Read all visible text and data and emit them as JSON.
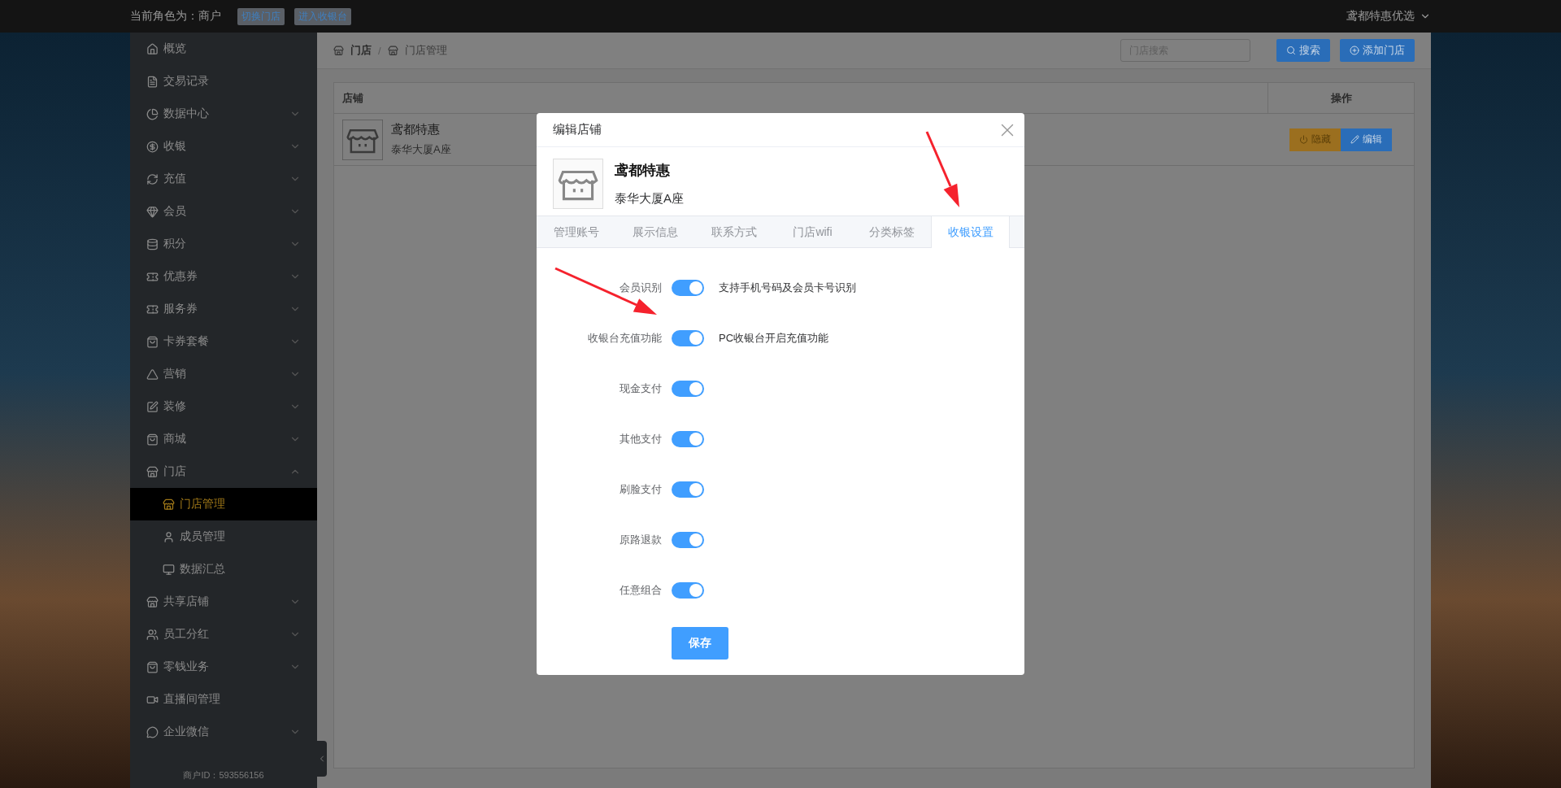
{
  "top_bar": {
    "role_text": "当前角色为：商户",
    "buttons": [
      "切换门店",
      "进入收银台"
    ],
    "user": "鸢都特惠优选"
  },
  "sidebar": {
    "items": [
      {
        "label": "概览",
        "kind": "link",
        "selected": false
      },
      {
        "label": "交易记录",
        "kind": "link",
        "selected": false
      },
      {
        "label": "数据中心",
        "kind": "group",
        "expanded": false,
        "selected": false
      },
      {
        "label": "收银",
        "kind": "group",
        "expanded": false,
        "selected": false
      },
      {
        "label": "充值",
        "kind": "group",
        "expanded": false,
        "selected": false
      },
      {
        "label": "会员",
        "kind": "group",
        "expanded": false,
        "selected": false
      },
      {
        "label": "积分",
        "kind": "group",
        "expanded": false,
        "selected": false
      },
      {
        "label": "优惠券",
        "kind": "group",
        "expanded": false,
        "selected": false
      },
      {
        "label": "服务券",
        "kind": "group",
        "expanded": false,
        "selected": false
      },
      {
        "label": "卡券套餐",
        "kind": "group",
        "expanded": false,
        "selected": false
      },
      {
        "label": "营销",
        "kind": "group",
        "expanded": false,
        "selected": false
      },
      {
        "label": "装修",
        "kind": "group",
        "expanded": false,
        "selected": false
      },
      {
        "label": "商城",
        "kind": "group",
        "expanded": false,
        "selected": false
      },
      {
        "label": "门店",
        "kind": "group",
        "expanded": true,
        "selected": false,
        "children": [
          {
            "label": "门店管理",
            "selected": true
          },
          {
            "label": "成员管理",
            "selected": false
          },
          {
            "label": "数据汇总",
            "selected": false
          }
        ]
      },
      {
        "label": "共享店铺",
        "kind": "group",
        "expanded": false,
        "selected": false
      },
      {
        "label": "员工分红",
        "kind": "group",
        "expanded": false,
        "selected": false
      },
      {
        "label": "零钱业务",
        "kind": "group",
        "expanded": false,
        "selected": false
      },
      {
        "label": "直播间管理",
        "kind": "link",
        "selected": false
      },
      {
        "label": "企业微信",
        "kind": "group",
        "expanded": false,
        "selected": false
      }
    ],
    "footer": "商户ID：593556156"
  },
  "header": {
    "breadcrumb": [
      "门店",
      "门店管理"
    ],
    "breadcrumb_separator": "/",
    "search": {
      "placeholder": "门店搜索"
    },
    "buttons": [
      "搜索",
      "添加门店"
    ]
  },
  "table": {
    "columns": [
      "店铺",
      "操作"
    ],
    "rows": [
      {
        "store_name": "鸢都特惠",
        "address": "泰华大厦A座",
        "actions": [
          {
            "label": "隐藏",
            "kind": "warning"
          },
          {
            "label": "编辑",
            "kind": "primary"
          }
        ]
      }
    ]
  },
  "modal": {
    "title": "编辑店铺",
    "store": {
      "name": "鸢都特惠",
      "address": "泰华大厦A座"
    },
    "tabs": [
      {
        "label": "管理账号",
        "selected": false
      },
      {
        "label": "展示信息",
        "selected": false
      },
      {
        "label": "联系方式",
        "selected": false
      },
      {
        "label": "门店wifi",
        "selected": false
      },
      {
        "label": "分类标签",
        "selected": false
      },
      {
        "label": "收银设置",
        "selected": true
      }
    ],
    "settings": [
      {
        "label": "会员识别",
        "on": true,
        "description": "支持手机号码及会员卡号识别"
      },
      {
        "label": "收银台充值功能",
        "on": true,
        "description": "PC收银台开启充值功能"
      },
      {
        "label": "现金支付",
        "on": true
      },
      {
        "label": "其他支付",
        "on": true
      },
      {
        "label": "刷脸支付",
        "on": true
      },
      {
        "label": "原路退款",
        "on": true
      },
      {
        "label": "任意组合",
        "on": true
      }
    ],
    "save_button": "保存"
  }
}
